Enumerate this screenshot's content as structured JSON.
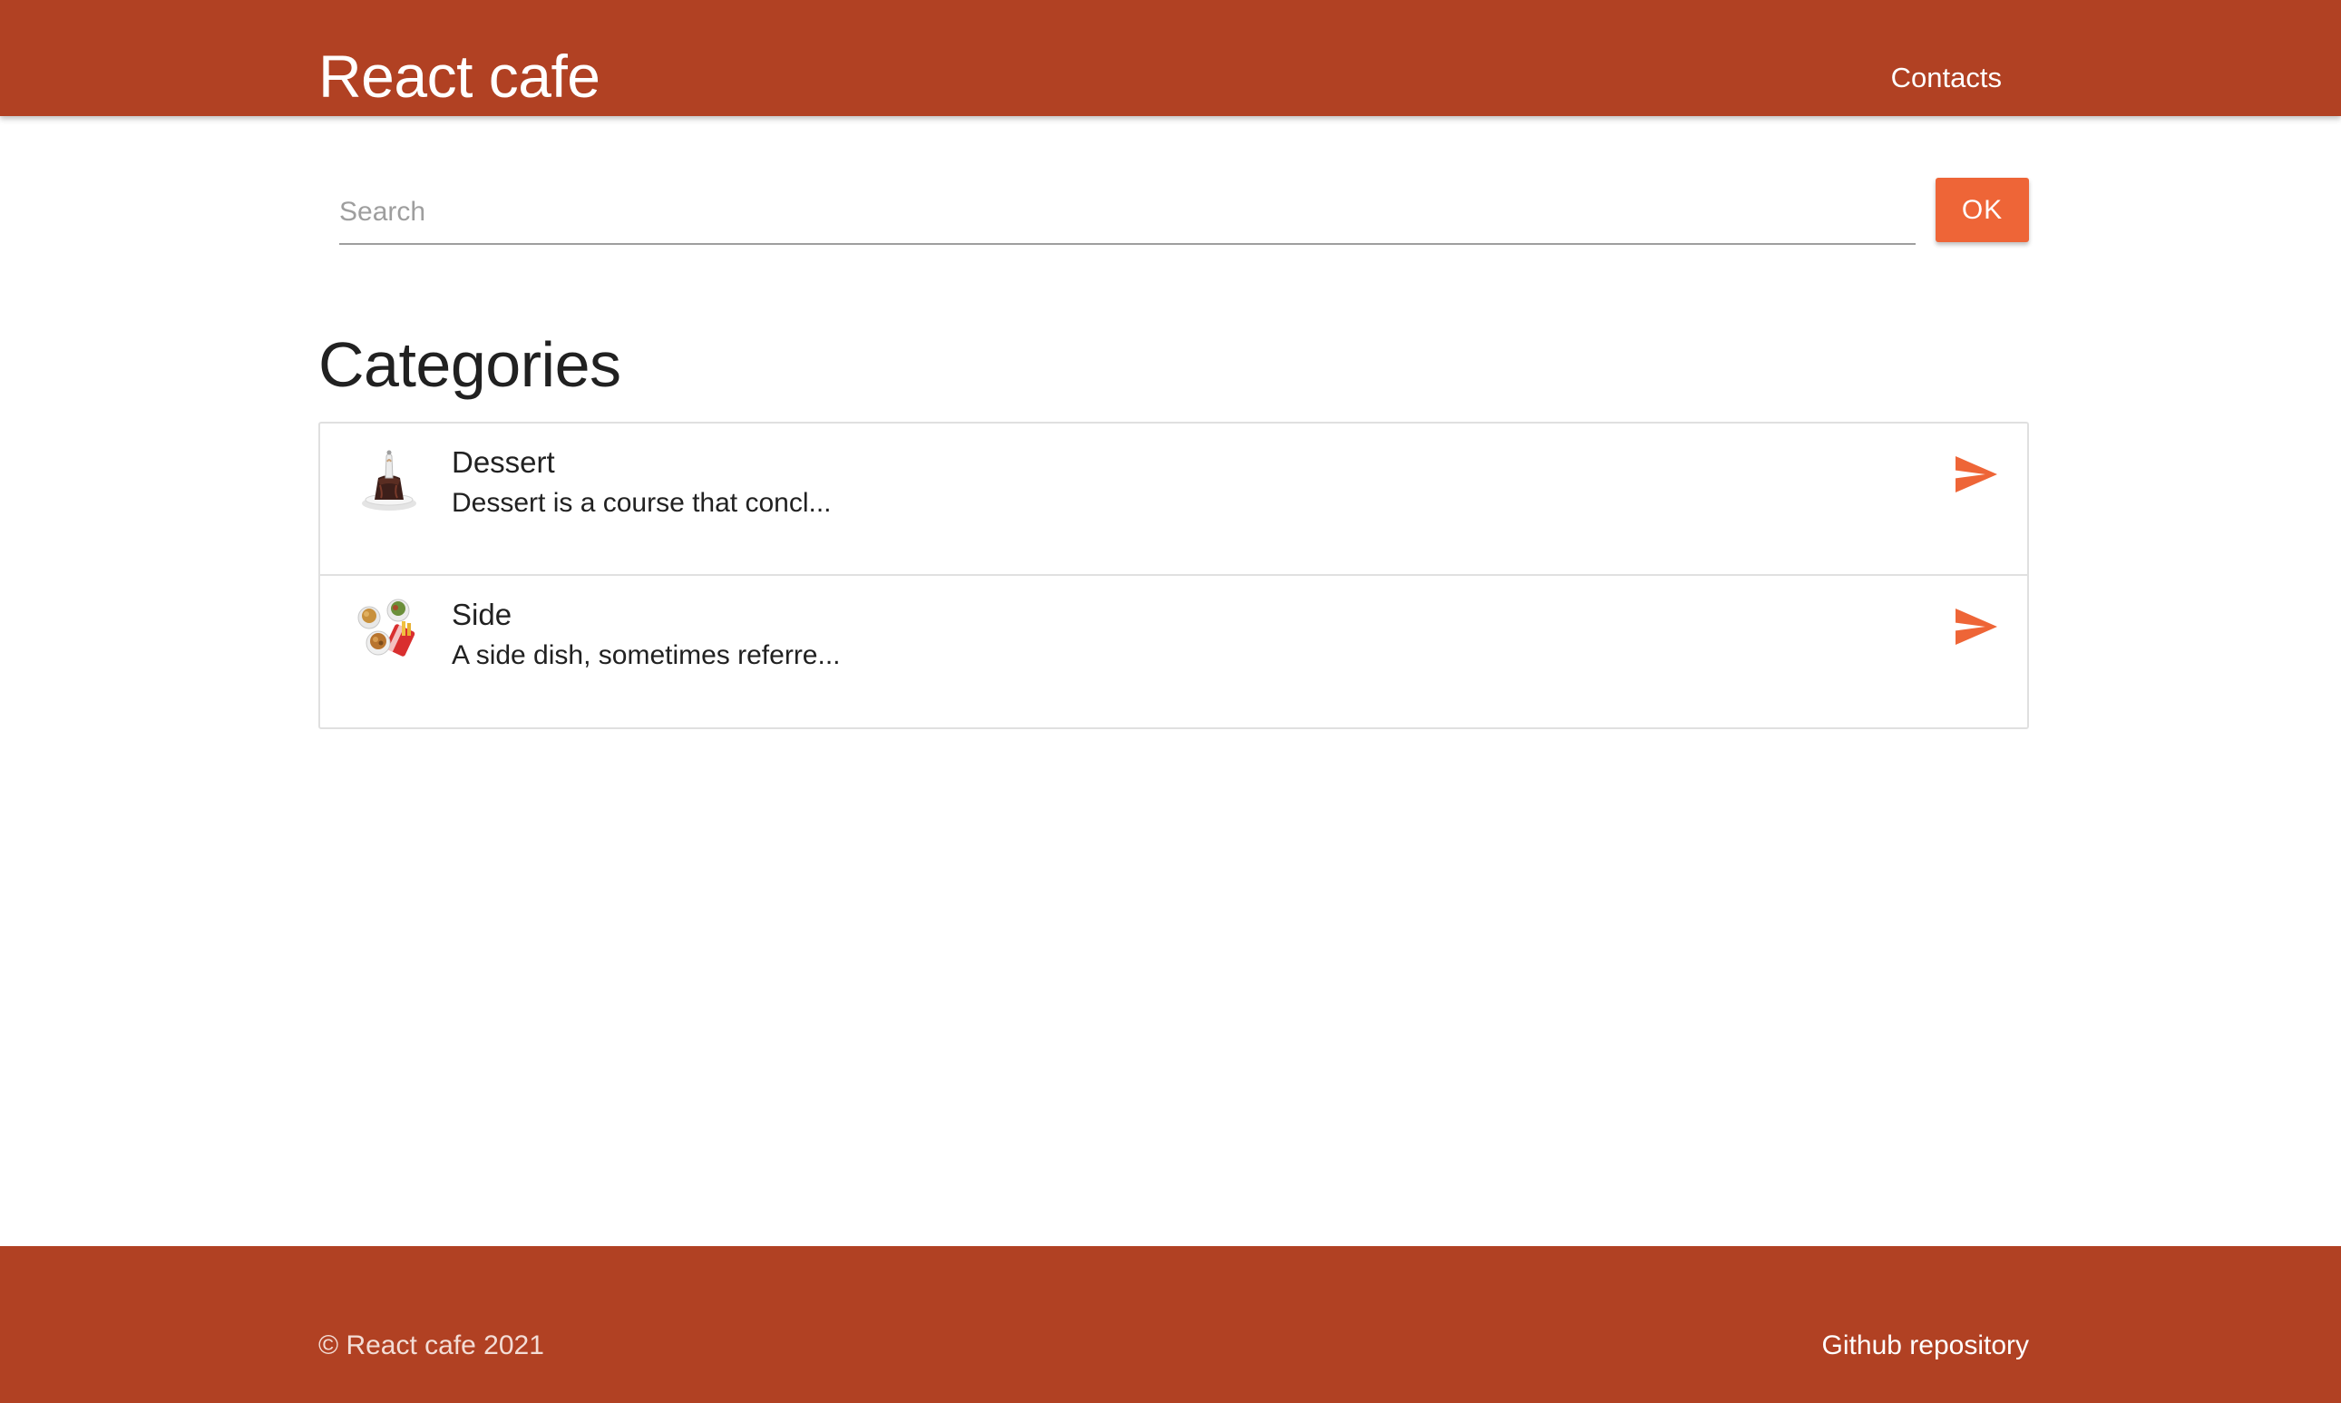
{
  "header": {
    "brand": "React cafe",
    "nav_link": "Contacts"
  },
  "search": {
    "value": "",
    "placeholder": "Search",
    "button_label": "OK"
  },
  "main": {
    "title": "Categories",
    "categories": [
      {
        "name": "Dessert",
        "description": "Dessert is a course that concl...",
        "icon": "send-icon"
      },
      {
        "name": "Side",
        "description": "A side dish, sometimes referre...",
        "icon": "send-icon"
      }
    ]
  },
  "footer": {
    "copyright": "© React cafe 2021",
    "link": "Github repository"
  },
  "colors": {
    "primary": "#b14123",
    "accent": "#ee6537"
  }
}
